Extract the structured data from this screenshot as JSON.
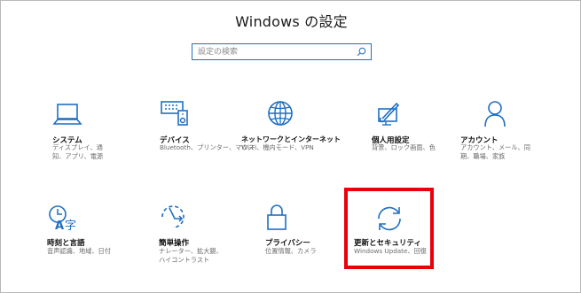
{
  "window": {
    "title": "Windows の設定"
  },
  "search": {
    "placeholder": "設定の検索"
  },
  "items": [
    {
      "label": "システム",
      "desc": "ディスプレイ、通知、アプリ、電源",
      "icon": "laptop-icon"
    },
    {
      "label": "デバイス",
      "desc": "Bluetooth、プリンター、マウス",
      "icon": "devices-icon"
    },
    {
      "label": "ネットワークとインターネット",
      "desc": "Wi-Fi、機内モード、VPN",
      "icon": "globe-icon"
    },
    {
      "label": "個人用設定",
      "desc": "背景、ロック画面、色",
      "icon": "paint-icon"
    },
    {
      "label": "アカウント",
      "desc": "アカウント、メール、同期、職場、家族",
      "icon": "person-icon"
    },
    {
      "label": "時刻と言語",
      "desc": "音声認識、地域、日付",
      "icon": "time-language-icon"
    },
    {
      "label": "簡単操作",
      "desc": "ナレーター、拡大鏡、ハイコントラスト",
      "icon": "ease-of-access-icon"
    },
    {
      "label": "プライバシー",
      "desc": "位置情報、カメラ",
      "icon": "lock-icon"
    },
    {
      "label": "更新とセキュリティ",
      "desc": "Windows Update、回復",
      "icon": "sync-icon"
    }
  ],
  "colors": {
    "accent": "#1e6fc1",
    "highlight": "#e8000b"
  }
}
